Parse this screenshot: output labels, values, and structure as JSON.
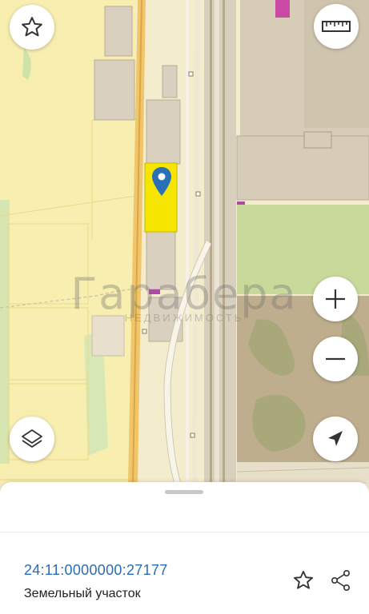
{
  "map": {
    "watermark_title": "Гарабера",
    "watermark_subtitle": "НЕДВИЖИМОСТЬ"
  },
  "controls": {
    "favorite_icon": "star-outline-icon",
    "ruler_icon": "ruler-icon",
    "zoom_in_icon": "plus-icon",
    "zoom_out_icon": "minus-icon",
    "layers_icon": "layers-icon",
    "locate_icon": "navigation-arrow-icon"
  },
  "parcel": {
    "cadastral_number": "24:11:0000000:27177",
    "type": "Земельный участок",
    "highlight_color": "#f5e500",
    "marker_color": "#2a70b8"
  },
  "sheet": {
    "favorite_icon": "star-outline-icon",
    "share_icon": "share-icon"
  }
}
